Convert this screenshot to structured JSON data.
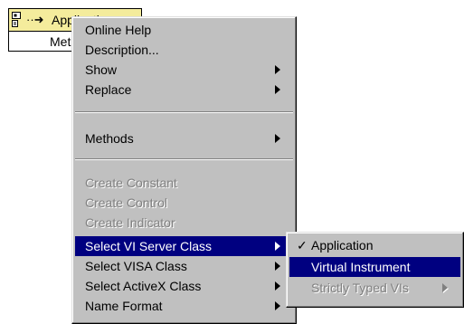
{
  "node": {
    "title": "Application",
    "property_item": "Methods"
  },
  "context_menu": {
    "items": [
      {
        "label": "Online Help"
      },
      {
        "label": "Description..."
      },
      {
        "label": "Show"
      },
      {
        "label": "Replace"
      },
      {
        "label": "Methods"
      },
      {
        "label": "Create Constant"
      },
      {
        "label": "Create Control"
      },
      {
        "label": "Create Indicator"
      },
      {
        "label": "Select VI Server Class"
      },
      {
        "label": "Select VISA Class"
      },
      {
        "label": "Select ActiveX Class"
      },
      {
        "label": "Name Format"
      }
    ]
  },
  "submenu": {
    "items": [
      {
        "label": "Application",
        "checked": true,
        "check_glyph": "✓"
      },
      {
        "label": "Virtual Instrument"
      },
      {
        "label": "Strictly Typed VIs"
      }
    ]
  },
  "colors": {
    "menu_background": "#c0c0c0",
    "highlight": "#000080",
    "node_header": "#f4ec9c",
    "disabled_text": "#808080"
  }
}
